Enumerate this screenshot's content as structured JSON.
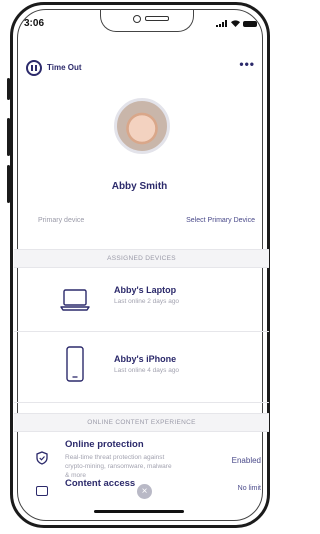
{
  "status_bar": {
    "time": "3:06"
  },
  "header": {
    "action_label": "Time Out",
    "more_label": "•••"
  },
  "profile": {
    "name": "Abby Smith",
    "primary_label": "Primary device",
    "primary_action": "Select Primary Device"
  },
  "assigned_devices": {
    "heading": "ASSIGNED DEVICES",
    "items": [
      {
        "name": "Abby's Laptop",
        "status": "Last online 2 days ago",
        "icon": "laptop-icon"
      },
      {
        "name": "Abby's iPhone",
        "status": "Last online 4 days ago",
        "icon": "phone-icon"
      }
    ]
  },
  "online_content": {
    "heading": "ONLINE CONTENT EXPERIENCE",
    "items": [
      {
        "title": "Online protection",
        "description": "Real-time threat protection against crypto-mining, ransomware, malware & more",
        "state": "Enabled",
        "icon": "shield-icon"
      },
      {
        "title": "Content access",
        "state": "No limit",
        "icon": "content-icon"
      }
    ]
  },
  "fab": {
    "label": "×"
  }
}
